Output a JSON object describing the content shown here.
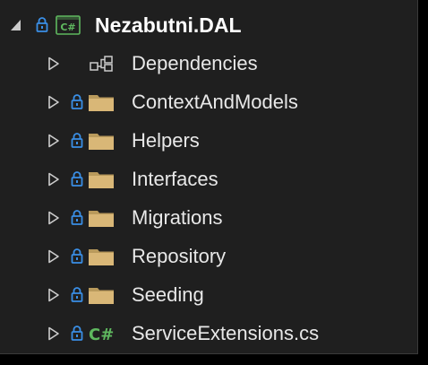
{
  "solution_explorer": {
    "project": {
      "name": "Nezabutni.DAL",
      "badge": "C#",
      "expanded": true,
      "icon": "csharp-project-icon"
    },
    "items": [
      {
        "label": "Dependencies",
        "type": "dependencies",
        "icon": "dependencies-icon"
      },
      {
        "label": "ContextAndModels",
        "type": "folder",
        "icon": "folder-icon"
      },
      {
        "label": "Helpers",
        "type": "folder",
        "icon": "folder-icon"
      },
      {
        "label": "Interfaces",
        "type": "folder",
        "icon": "folder-icon"
      },
      {
        "label": "Migrations",
        "type": "folder",
        "icon": "folder-icon"
      },
      {
        "label": "Repository",
        "type": "folder",
        "icon": "folder-icon"
      },
      {
        "label": "Seeding",
        "type": "folder",
        "icon": "folder-icon"
      },
      {
        "label": "ServiceExtensions.cs",
        "type": "csharp-file",
        "file_badge": "C#",
        "icon": "csharp-file-icon"
      }
    ]
  },
  "colors": {
    "background": "#1f1f1f",
    "text": "#e8e8e8",
    "lock": "#3a8fe6",
    "folder": "#d9b777",
    "folder_dark": "#b99a5c",
    "csharp_green": "#5fb85f",
    "expander": "#cccccc"
  }
}
